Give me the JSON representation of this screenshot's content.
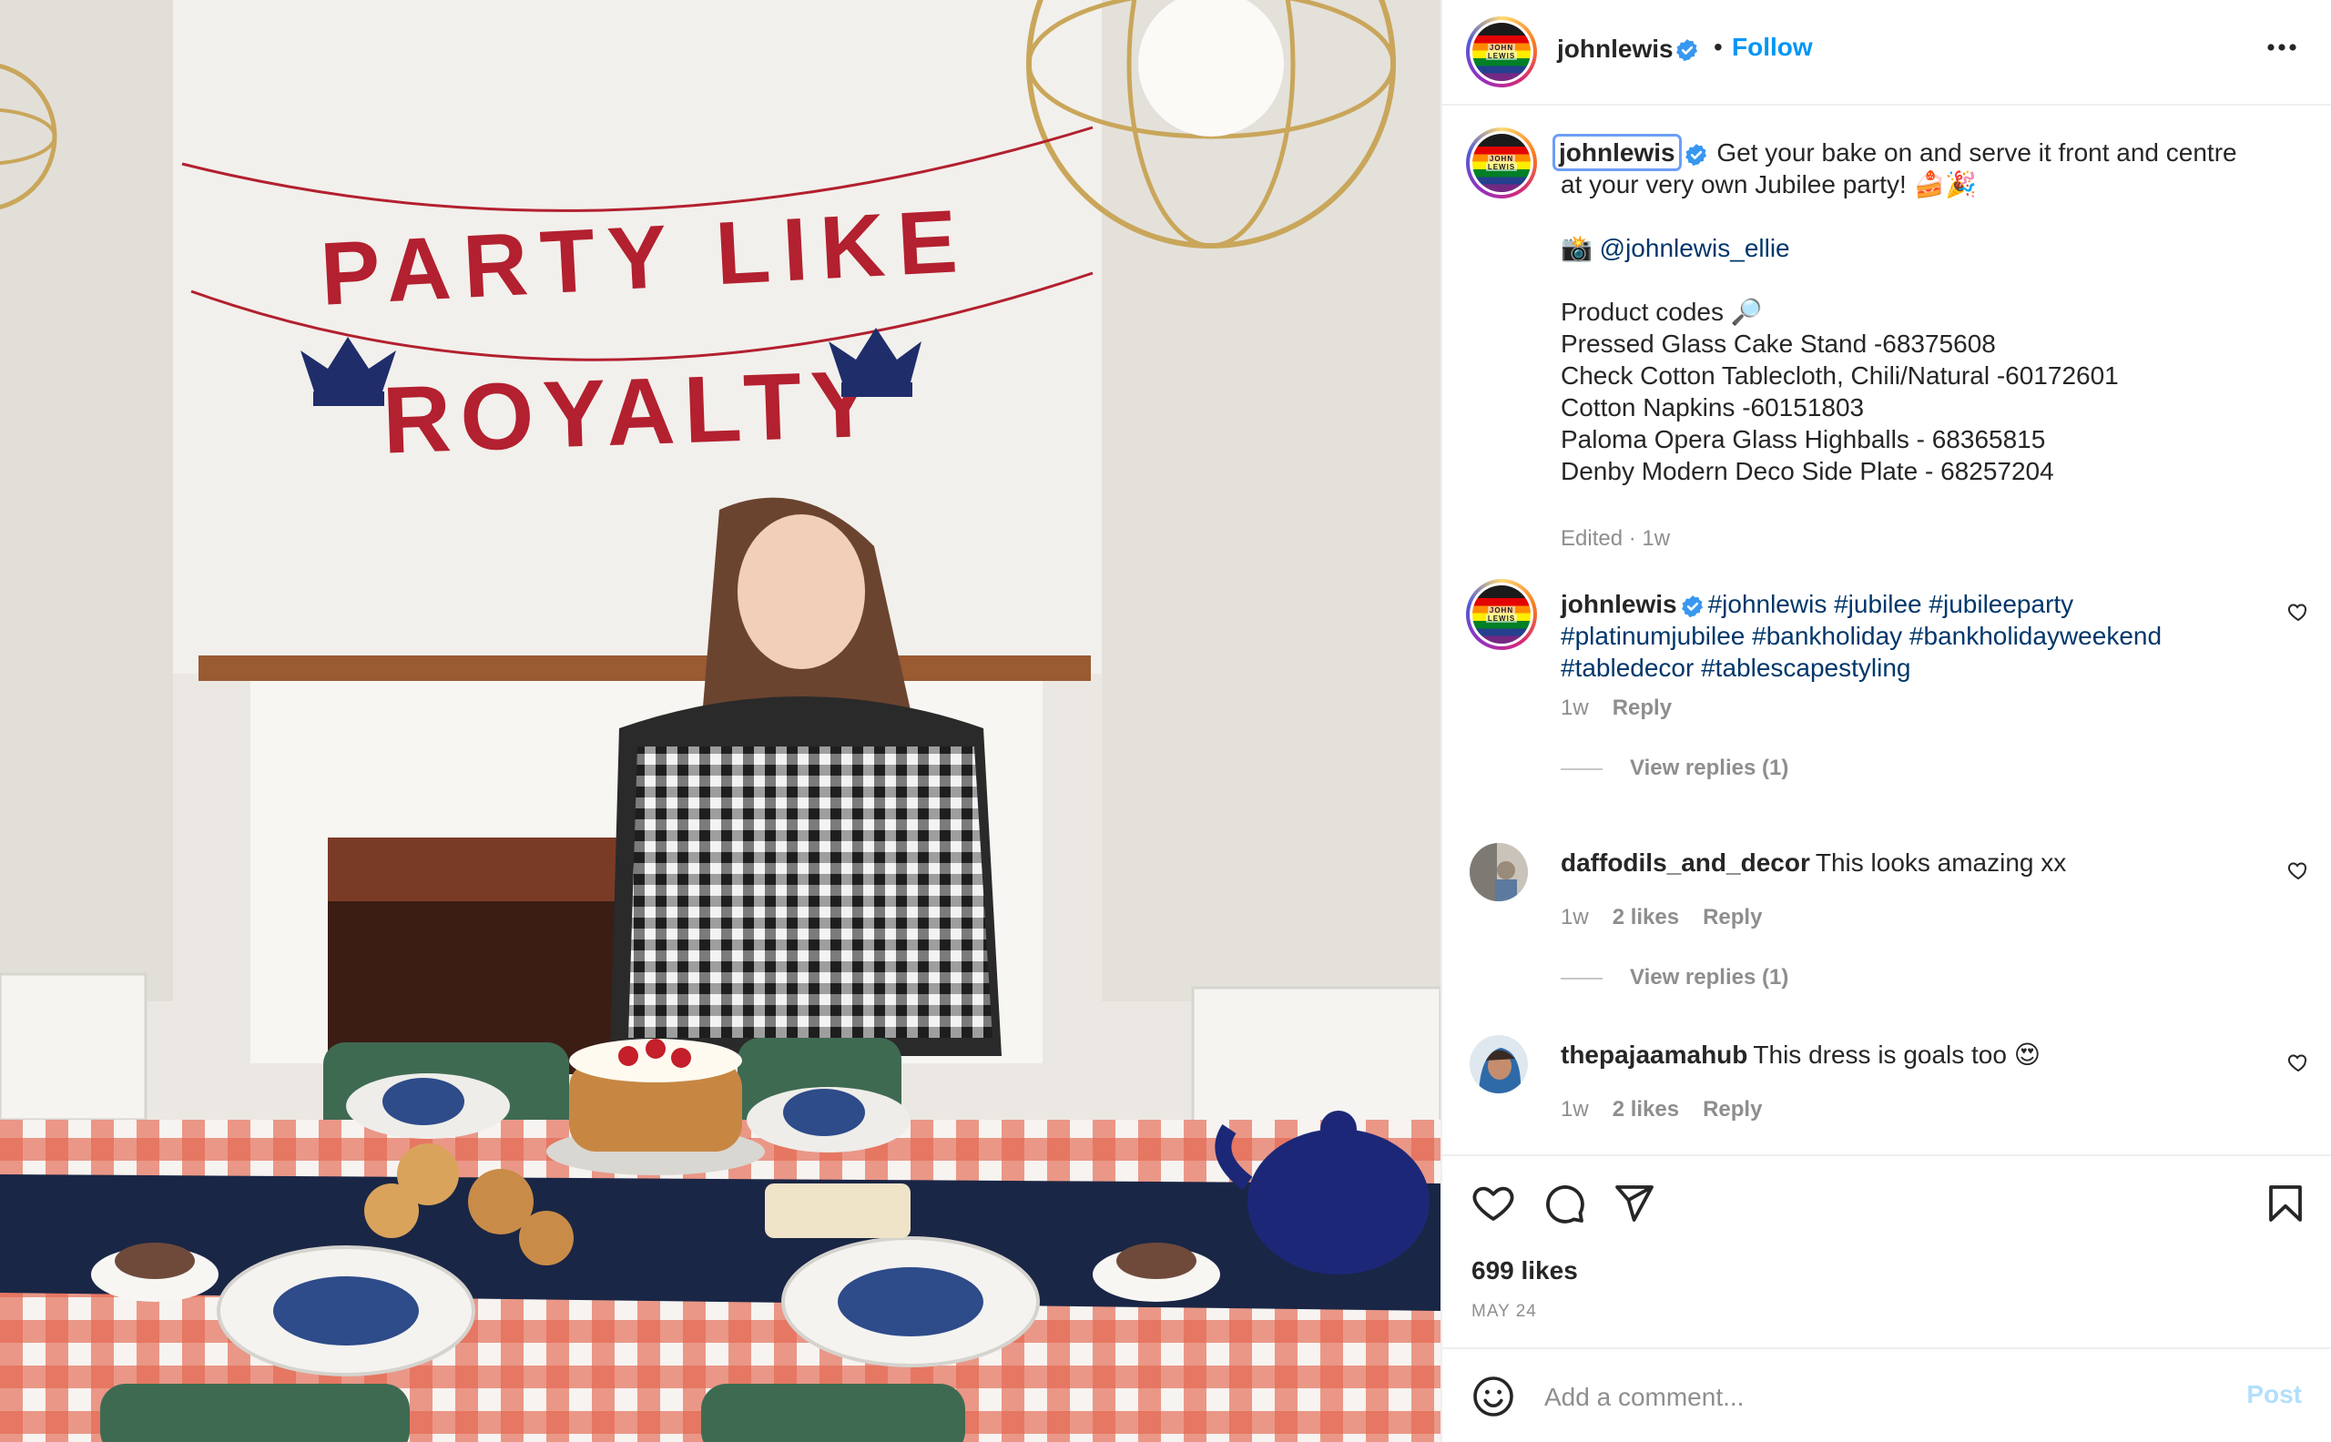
{
  "photo": {
    "banner_line1": "PARTY LIKE",
    "banner_line2": "ROYALTY",
    "banner_color": "#b3202f",
    "crown_color": "#1f2d6b"
  },
  "header": {
    "username": "johnlewis",
    "separator": "•",
    "follow_label": "Follow",
    "more_icon": "more-horizontal-icon"
  },
  "avatar_text": [
    "JOHN",
    "LEWIS",
    "& PARTNERS"
  ],
  "caption": {
    "username": "johnlewis",
    "text": "Get your bake on and serve it front and centre at your very own Jubilee party! 🍰🎉",
    "credit_prefix": "📸",
    "credit_mention": "@johnlewis_ellie",
    "codes_title": "Product codes 🔎",
    "codes": [
      "Pressed Glass Cake Stand -68375608",
      "Check Cotton Tablecloth, Chili/Natural -60172601",
      "Cotton Napkins -60151803",
      "Paloma Opera Glass Highballs - 68365815",
      "Denby Modern Deco Side Plate - 68257204"
    ],
    "meta": "Edited · 1w"
  },
  "comments": [
    {
      "username": "johnlewis",
      "text": "#johnlewis #jubilee #jubileeparty #platinumjubilee #bankholiday #bankholidayweekend #tabledecor #tablescapestyling",
      "time": "1w",
      "likes": "",
      "reply_label": "Reply",
      "view_replies": "View replies (1)"
    },
    {
      "username": "daffodils_and_decor",
      "text": "This looks amazing xx",
      "time": "1w",
      "likes": "2 likes",
      "reply_label": "Reply",
      "view_replies": "View replies (1)"
    },
    {
      "username": "thepajaamahub",
      "text": "This dress is goals too 😍",
      "time": "1w",
      "likes": "2 likes",
      "reply_label": "Reply"
    }
  ],
  "actions": {
    "likes": "699 likes",
    "date": "MAY 24"
  },
  "add_comment": {
    "placeholder": "Add a comment...",
    "post_label": "Post"
  },
  "colors": {
    "link": "#00376b",
    "follow": "#0095f6",
    "post_disabled": "#b2dffc",
    "muted": "#8e8e8e"
  }
}
